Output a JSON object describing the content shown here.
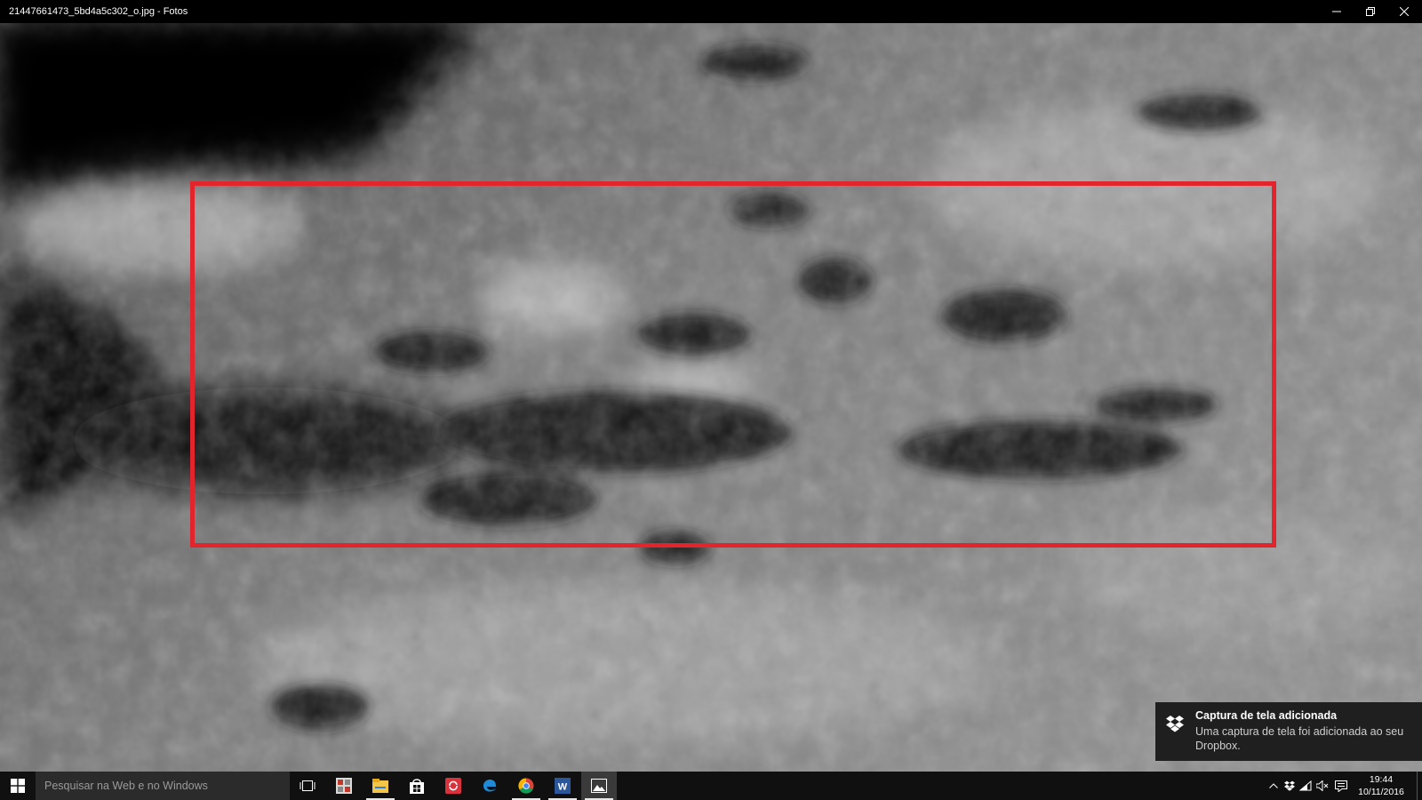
{
  "window": {
    "title": "21447661473_5bd4a5c302_o.jpg - Fotos",
    "controls": [
      "minimize-icon",
      "restore-icon",
      "close-icon"
    ]
  },
  "annotation": {
    "color": "#e2242c"
  },
  "notification": {
    "title": "Captura de tela adicionada",
    "body": "Uma captura de tela foi adicionada ao seu Dropbox."
  },
  "taskbar": {
    "search_placeholder": "Pesquisar na Web e no Windows",
    "apps": [
      "task-view-icon",
      "photo-gallery-icon",
      "file-explorer-icon",
      "store-icon",
      "sync-app-icon",
      "edge-icon",
      "chrome-icon",
      "word-icon",
      "photos-icon"
    ],
    "tray_icons": [
      "show-hidden-icons-icon",
      "dropbox-tray-icon",
      "network-icon",
      "volume-muted-icon",
      "action-center-icon"
    ],
    "time": "19:44",
    "date": "10/11/2016"
  }
}
